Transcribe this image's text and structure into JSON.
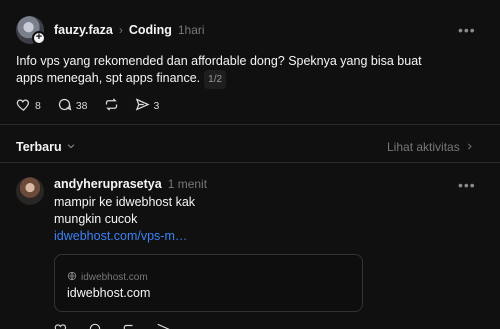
{
  "post": {
    "username": "fauzy.faza",
    "separator": "›",
    "topic": "Coding",
    "time": "1hari",
    "text": "Info vps yang rekomended dan affordable dong? Speknya yang bisa buat apps menegah, spt apps finance.",
    "page_indicator": "1/2",
    "likes": "8",
    "replies": "38",
    "shares": "3",
    "more": "•••"
  },
  "reply_header": {
    "sort_label": "Terbaru",
    "activity_label": "Lihat aktivitas"
  },
  "reply": {
    "username": "andyheruprasetya",
    "time": "1 menit",
    "line1": "mampir ke idwebhost kak",
    "line2": "mungkin cucok",
    "link": "idwebhost.com/vps-m…",
    "card_domain": "idwebhost.com",
    "card_title": "idwebhost.com",
    "more": "•••"
  },
  "icons": [
    "heart-icon",
    "comment-icon",
    "repost-icon",
    "share-icon",
    "chevron-down-icon",
    "chevron-right-icon",
    "globe-icon",
    "more-icon"
  ]
}
